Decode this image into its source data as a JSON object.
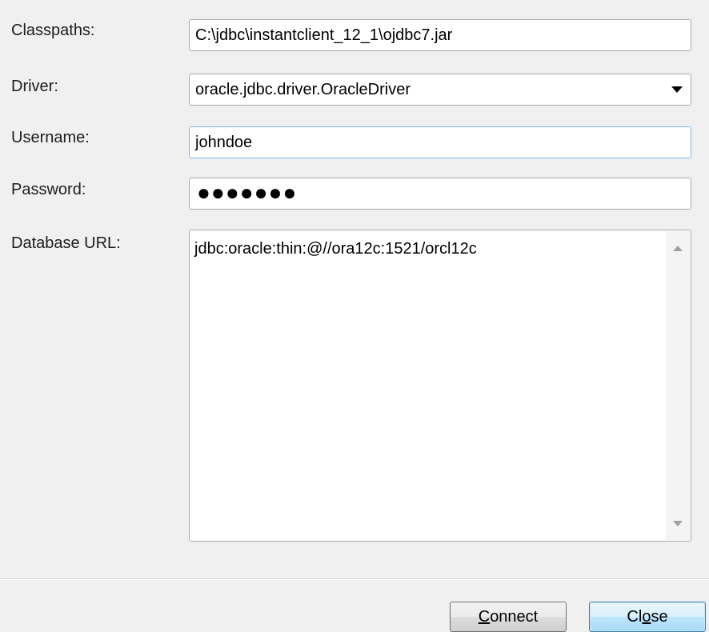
{
  "form": {
    "classpaths": {
      "label": "Classpaths:",
      "value": "C:\\jdbc\\instantclient_12_1\\ojdbc7.jar"
    },
    "driver": {
      "label": "Driver:",
      "value": "oracle.jdbc.driver.OracleDriver"
    },
    "username": {
      "label": "Username:",
      "value": "johndoe"
    },
    "password": {
      "label": "Password:",
      "masked_value": "●●●●●●●"
    },
    "database_url": {
      "label": "Database URL:",
      "value": "jdbc:oracle:thin:@//ora12c:1521/orcl12c"
    }
  },
  "buttons": {
    "connect": {
      "mnemonic": "C",
      "rest": "onnect"
    },
    "close": {
      "pre": "Cl",
      "mnemonic": "o",
      "rest": "se"
    }
  },
  "icons": {
    "dropdown": "chevron-down-icon",
    "scroll_up": "scroll-up-arrow-icon",
    "scroll_down": "scroll-down-arrow-icon"
  },
  "colors": {
    "background": "#f0f0f0",
    "focus_border": "#7eb4ea",
    "default_button_border": "#3c7fb1"
  }
}
